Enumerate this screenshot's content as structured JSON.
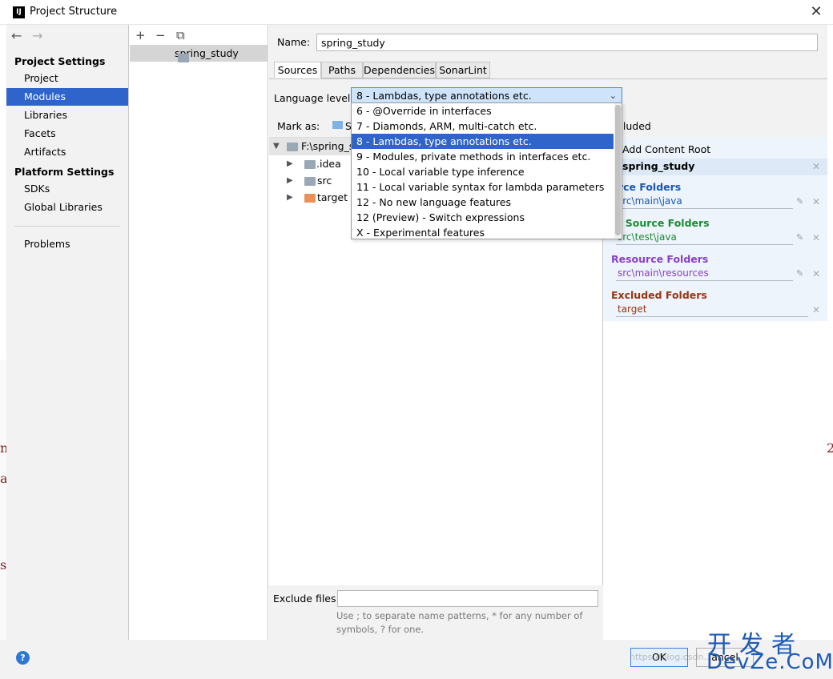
{
  "window": {
    "title": "Project Structure",
    "close_glyph": "✕"
  },
  "nav": {
    "back": "←",
    "forward": "→",
    "project_settings": "Project Settings",
    "project_items": [
      "Project",
      "Modules",
      "Libraries",
      "Facets",
      "Artifacts"
    ],
    "selected": "Modules",
    "platform_settings": "Platform Settings",
    "platform_items": [
      "SDKs",
      "Global Libraries"
    ],
    "problems": "Problems"
  },
  "modules": {
    "toolbar": {
      "add": "+",
      "remove": "−",
      "copy": "⧉"
    },
    "items": [
      "spring_study"
    ]
  },
  "main": {
    "name_label": "Name:",
    "name_value": "spring_study",
    "tabs": [
      "Sources",
      "Paths",
      "Dependencies",
      "SonarLint"
    ],
    "active_tab": "Sources",
    "language_level_label": "Language level:",
    "language_level_value": "8 - Lambdas, type annotations etc.",
    "mark_as_label": "Mark as:",
    "mark_as_partial": "S",
    "excluded_partial": "cluded",
    "tree": {
      "root": "F:\\spring_s",
      "children": [
        {
          "name": ".idea",
          "icon": "folder-icon"
        },
        {
          "name": "src",
          "icon": "folder-icon"
        },
        {
          "name": "target",
          "icon": "excluded-folder-icon"
        }
      ]
    },
    "exclude_files_label": "Exclude files:",
    "exclude_files_value": "",
    "exclude_hint_1": "Use ; to separate name patterns, * for any number of",
    "exclude_hint_2": "symbols, ? for one."
  },
  "dropdown": {
    "options": [
      "6 - @Override in interfaces",
      "7 - Diamonds, ARM, multi-catch etc.",
      "8 - Lambdas, type annotations etc.",
      "9 - Modules, private methods in interfaces etc.",
      "10 - Local variable type inference",
      "11 - Local variable syntax for lambda parameters",
      "12 - No new language features",
      "12 (Preview) - Switch expressions",
      "X - Experimental features"
    ],
    "selected": "8 - Lambdas, type annotations etc."
  },
  "roots": {
    "add_content_root": "Add Content Root",
    "content_root": "spring_study",
    "source_head": "urce Folders",
    "source_path": "src\\main\\java",
    "test_head": "st Source Folders",
    "test_path": "src\\test\\java",
    "resource_head": "Resource Folders",
    "resource_path": "src\\main\\resources",
    "excluded_head": "Excluded Folders",
    "excluded_path": "target",
    "colors": {
      "source": "#1a56b4",
      "test": "#1d8a33",
      "resource": "#8a3ec9",
      "excluded": "#9a3412"
    }
  },
  "footer": {
    "help": "?",
    "ok": "OK",
    "cancel": "ancel"
  },
  "watermark": {
    "top": "开发者",
    "bottom": "DevZe.CoM",
    "url": "https://blog.csdn..."
  },
  "background_glyphs": [
    "n",
    "a",
    "s",
    "2"
  ]
}
